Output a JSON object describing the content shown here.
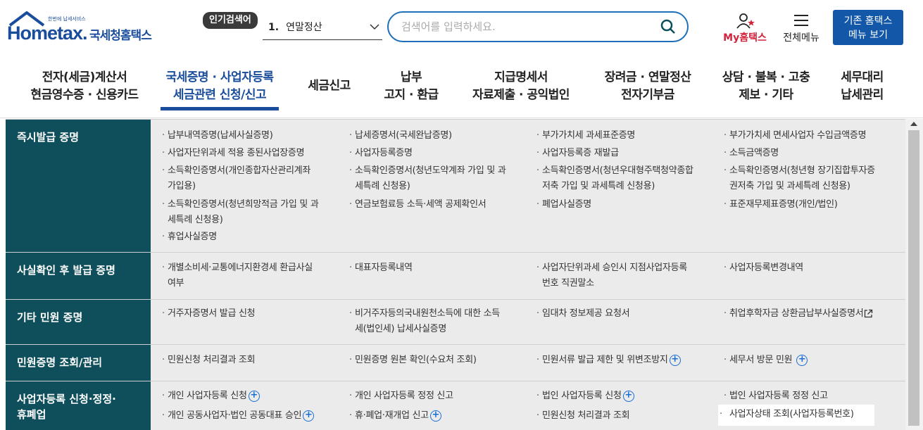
{
  "header": {
    "logo_small_tagline": "한번에 납세서비스",
    "logo_text": "Hometax.",
    "logo_name": "국세청홈택스",
    "popular_badge": "인기검색어",
    "popular_rank": "1.",
    "popular_keyword": "연말정산",
    "search_placeholder": "검색어를 입력하세요.",
    "my_hometax": "My홈택스",
    "all_menu": "전체메뉴",
    "old_home_line1": "기존 홈택스",
    "old_home_line2": "메뉴 보기"
  },
  "nav": [
    {
      "line1": "전자(세금)계산서",
      "line2": "현금영수증 · 신용카드"
    },
    {
      "line1": "국세증명 · 사업자등록",
      "line2": "세금관련 신청/신고"
    },
    {
      "line1": "세금신고",
      "line2": ""
    },
    {
      "line1": "납부",
      "line2": "고지 · 환급"
    },
    {
      "line1": "지급명세서",
      "line2": "자료제출 · 공익법인"
    },
    {
      "line1": "장려금 · 연말정산",
      "line2": "전자기부금"
    },
    {
      "line1": "상담 · 불복 · 고충",
      "line2": "제보 · 기타"
    },
    {
      "line1": "세무대리",
      "line2": "납세관리"
    }
  ],
  "sections": [
    {
      "title_line1": "즉시발급 증명",
      "title_line2": "",
      "items": [
        [
          "납부내역증명(납세사실증명)",
          ""
        ],
        [
          "납세증명서(국세완납증명)",
          ""
        ],
        [
          "부가가치세 과세표준증명",
          ""
        ],
        [
          "부가가치세 면세사업자 수입금액증명",
          ""
        ],
        [
          "사업자단위과세 적용 종된사업장증명",
          ""
        ],
        [
          "사업자등록증명",
          ""
        ],
        [
          "사업자등록증 재발급",
          ""
        ],
        [
          "소득금액증명",
          ""
        ],
        [
          "소득확인증명서(개인종합자산관리계좌",
          "가입용)"
        ],
        [
          "소득확인증명서(청년도약계좌 가입 및 과",
          "세특례 신청용)"
        ],
        [
          "소득확인증명서(청년우대형주택청약종합",
          "저축 가입 및 과세특례 신청용)"
        ],
        [
          "소득확인증명서(청년형 장기집합투자증",
          "권저축 가입 및 과세특례 신청용)"
        ],
        [
          "소득확인증명서(청년희망적금 가입 및 과",
          "세특례 신청용)"
        ],
        [
          "연금보험료등 소득·세액 공제확인서",
          ""
        ],
        [
          "폐업사실증명",
          ""
        ],
        [
          "표준재무제표증명(개인/법인)",
          ""
        ],
        [
          "휴업사실증명",
          ""
        ]
      ]
    },
    {
      "title_line1": "사실확인 후 발급 증명",
      "title_line2": "",
      "items": [
        [
          "개별소비세·교통에너지환경세 환급사실",
          "여부"
        ],
        [
          "대표자등록내역",
          ""
        ],
        [
          "사업자단위과세 승인시 지점사업자등록",
          "번호 직권말소"
        ],
        [
          "사업자등록변경내역",
          ""
        ]
      ]
    },
    {
      "title_line1": "기타 민원 증명",
      "title_line2": "",
      "items": [
        [
          "거주자증명서 발급 신청",
          ""
        ],
        [
          "비거주자등의국내원천소득에 대한 소득",
          "세(법인세) 납세사실증명"
        ],
        [
          "임대차 정보제공 요청서",
          ""
        ],
        [
          "취업후학자금 상환금납부사실증명서",
          ""
        ]
      ]
    },
    {
      "title_line1": "민원증명 조회/관리",
      "title_line2": "",
      "items": [
        [
          "민원신청 처리결과 조회",
          ""
        ],
        [
          "민원증명 원본 확인(수요처 조회)",
          ""
        ],
        [
          "민원서류 발급 제한 및 위변조방지",
          ""
        ],
        [
          "세무서 방문 민원",
          ""
        ]
      ]
    },
    {
      "title_line1": "사업자등록 신청·정정·",
      "title_line2": "휴폐업",
      "items": [
        [
          "개인 사업자등록 신청",
          ""
        ],
        [
          "개인 사업자등록 정정 신고",
          ""
        ],
        [
          "법인 사업자등록 신청",
          ""
        ],
        [
          "법인 사업자등록 정정 신고",
          ""
        ],
        [
          "개인 공동사업자·법인 공동대표 승인",
          ""
        ],
        [
          "휴·폐업·재개업 신고",
          ""
        ],
        [
          "민원신청 처리결과 조회",
          ""
        ],
        [
          "사업자상태 조회(사업자등록번호)",
          ""
        ]
      ]
    }
  ],
  "colors": {
    "brand": "#1a4d9c",
    "section_head": "#0e4f5b",
    "plus": "#1a6fd6",
    "mytax": "#d2233b"
  },
  "icons": [
    "search-icon",
    "my-hometax-icon",
    "hamburger-menu-icon",
    "chevron-down-icon",
    "plus-circle-icon",
    "external-link-icon"
  ]
}
